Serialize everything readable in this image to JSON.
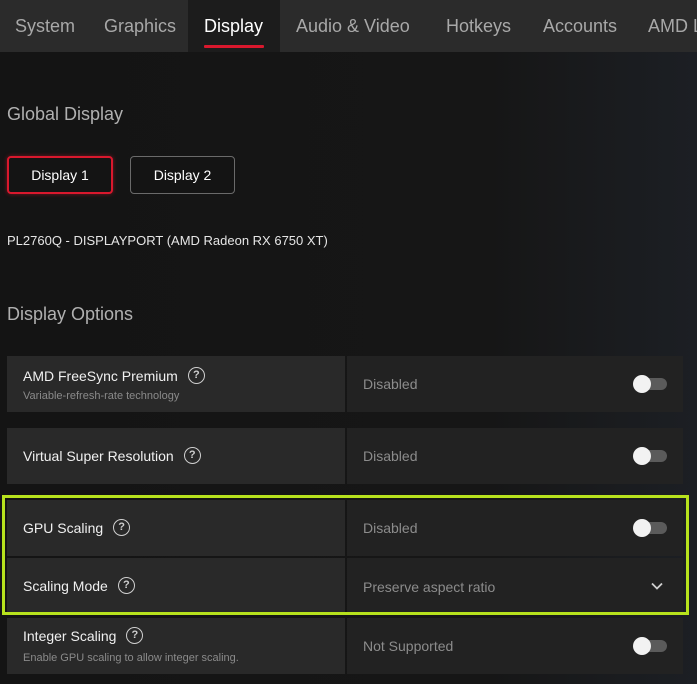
{
  "tabs": [
    {
      "label": "System",
      "active": false
    },
    {
      "label": "Graphics",
      "active": false
    },
    {
      "label": "Display",
      "active": true
    },
    {
      "label": "Audio & Video",
      "active": false
    },
    {
      "label": "Hotkeys",
      "active": false
    },
    {
      "label": "Accounts",
      "active": false
    },
    {
      "label": "AMD Link",
      "active": false
    }
  ],
  "global_display": {
    "title": "Global Display",
    "buttons": [
      "Display 1",
      "Display 2"
    ],
    "selected": "Display 1",
    "monitor": "PL2760Q - DISPLAYPORT (AMD Radeon RX 6750 XT)"
  },
  "display_options": {
    "title": "Display Options",
    "rows": [
      {
        "label": "AMD FreeSync Premium",
        "sub": "Variable-refresh-rate technology",
        "value": "Disabled",
        "control": "toggle",
        "on": false
      },
      {
        "label": "Virtual Super Resolution",
        "value": "Disabled",
        "control": "toggle",
        "on": false
      },
      {
        "label": "GPU Scaling",
        "value": "Disabled",
        "control": "toggle",
        "on": false
      },
      {
        "label": "Scaling Mode",
        "value": "Preserve aspect ratio",
        "control": "dropdown"
      },
      {
        "label": "Integer Scaling",
        "sub": "Enable GPU scaling to allow integer scaling.",
        "value": "Not Supported",
        "control": "toggle",
        "on": false
      }
    ]
  },
  "icons": {
    "help": "help-circle-icon",
    "help_glyph": "?",
    "dropdown": "chevron-down-icon"
  },
  "colors": {
    "accent": "#d9182d",
    "highlight": "#b7e21d"
  }
}
